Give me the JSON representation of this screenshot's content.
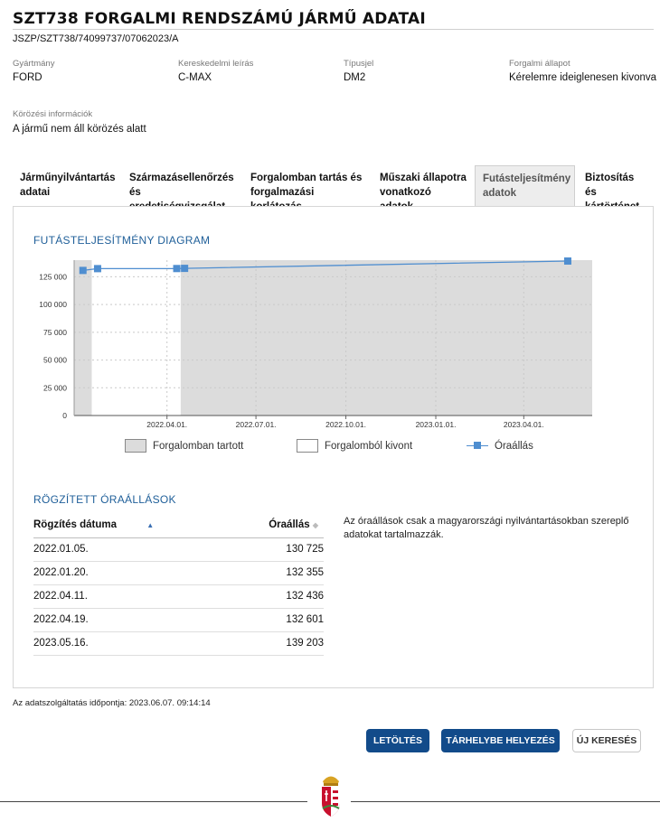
{
  "header": {
    "title": "SZT738 FORGALMI RENDSZÁMÚ JÁRMŰ ADATAI",
    "reference": "JSZP/SZT738/74099737/07062023/A"
  },
  "fields": {
    "manufacturer": {
      "label": "Gyártmány",
      "value": "FORD"
    },
    "commercial_name": {
      "label": "Kereskedelmi leírás",
      "value": "C-MAX"
    },
    "type_code": {
      "label": "Típusjel",
      "value": "DM2"
    },
    "traffic_status": {
      "label": "Forgalmi állapot",
      "value": "Kérelemre ideiglenesen kivonva"
    },
    "wanted_info": {
      "label": "Körözési információk",
      "value": "A jármű nem áll körözés alatt"
    }
  },
  "tabs": [
    {
      "line1": "Járműnyilvántartás",
      "line2": "adatai"
    },
    {
      "line1": "Származásellenőrzés",
      "line2": "és eredetiségvizsgálat"
    },
    {
      "line1": "Forgalomban tartás és",
      "line2": "forgalmazási korlátozás"
    },
    {
      "line1": "Műszaki állapotra",
      "line2": "vonatkozó adatok"
    },
    {
      "line1": "Futásteljesítmény",
      "line2": "adatok"
    },
    {
      "line1": "Biztosítás és",
      "line2": "kártörténet"
    }
  ],
  "chart_title": "FUTÁSTELJESÍTMÉNY DIAGRAM",
  "chart_data": {
    "type": "line",
    "x_range": [
      "2021-12-27",
      "2023-06-10"
    ],
    "ylim": [
      0,
      140000
    ],
    "y_ticks": [
      "0",
      "25 000",
      "50 000",
      "75 000",
      "100 000",
      "125 000"
    ],
    "y_tick_values": [
      0,
      25000,
      50000,
      75000,
      100000,
      125000
    ],
    "x_ticks": [
      "2022.04.01.",
      "2022.07.01.",
      "2022.10.01.",
      "2023.01.01.",
      "2023.04.01."
    ],
    "x_tick_dates": [
      "2022-04-01",
      "2022-07-01",
      "2022-10-01",
      "2023-01-01",
      "2023-04-01"
    ],
    "in_traffic_periods": [
      {
        "start": "2021-12-27",
        "end": "2022-01-14"
      },
      {
        "start": "2022-04-15",
        "end": "2023-06-10"
      }
    ],
    "series": [
      {
        "name": "Óraállás",
        "color": "#4f8ed0",
        "x": [
          "2022-01-05",
          "2022-01-20",
          "2022-04-11",
          "2022-04-19",
          "2023-05-16"
        ],
        "y": [
          130725,
          132355,
          132436,
          132601,
          139203
        ]
      }
    ],
    "legend": [
      "Forgalomban tartott",
      "Forgalomból kivont",
      "Óraállás"
    ],
    "legend_position": "bottom",
    "grid": true
  },
  "readings": {
    "title": "RÖGZÍTETT ÓRAÁLLÁSOK",
    "columns": [
      "Rögzítés dátuma",
      "Óraállás"
    ],
    "rows": [
      {
        "date": "2022.01.05.",
        "value": "130 725"
      },
      {
        "date": "2022.01.20.",
        "value": "132 355"
      },
      {
        "date": "2022.04.11.",
        "value": "132 436"
      },
      {
        "date": "2022.04.19.",
        "value": "132 601"
      },
      {
        "date": "2023.05.16.",
        "value": "139 203"
      }
    ],
    "note": "Az óraállások csak a magyarországi nyilvántartásokban szereplő adatokat tartalmazzák."
  },
  "timestamp": "Az adatszolgáltatás időpontja: 2023.06.07. 09:14:14",
  "buttons": {
    "download": "LETÖLTÉS",
    "store": "TÁRHELYBE HELYEZÉS",
    "new_search": "ÚJ KERESÉS"
  },
  "colors": {
    "primary": "#124b8a",
    "accent": "#1f5f99",
    "series": "#4f8ed0",
    "in_traffic": "#dcdcdc"
  }
}
